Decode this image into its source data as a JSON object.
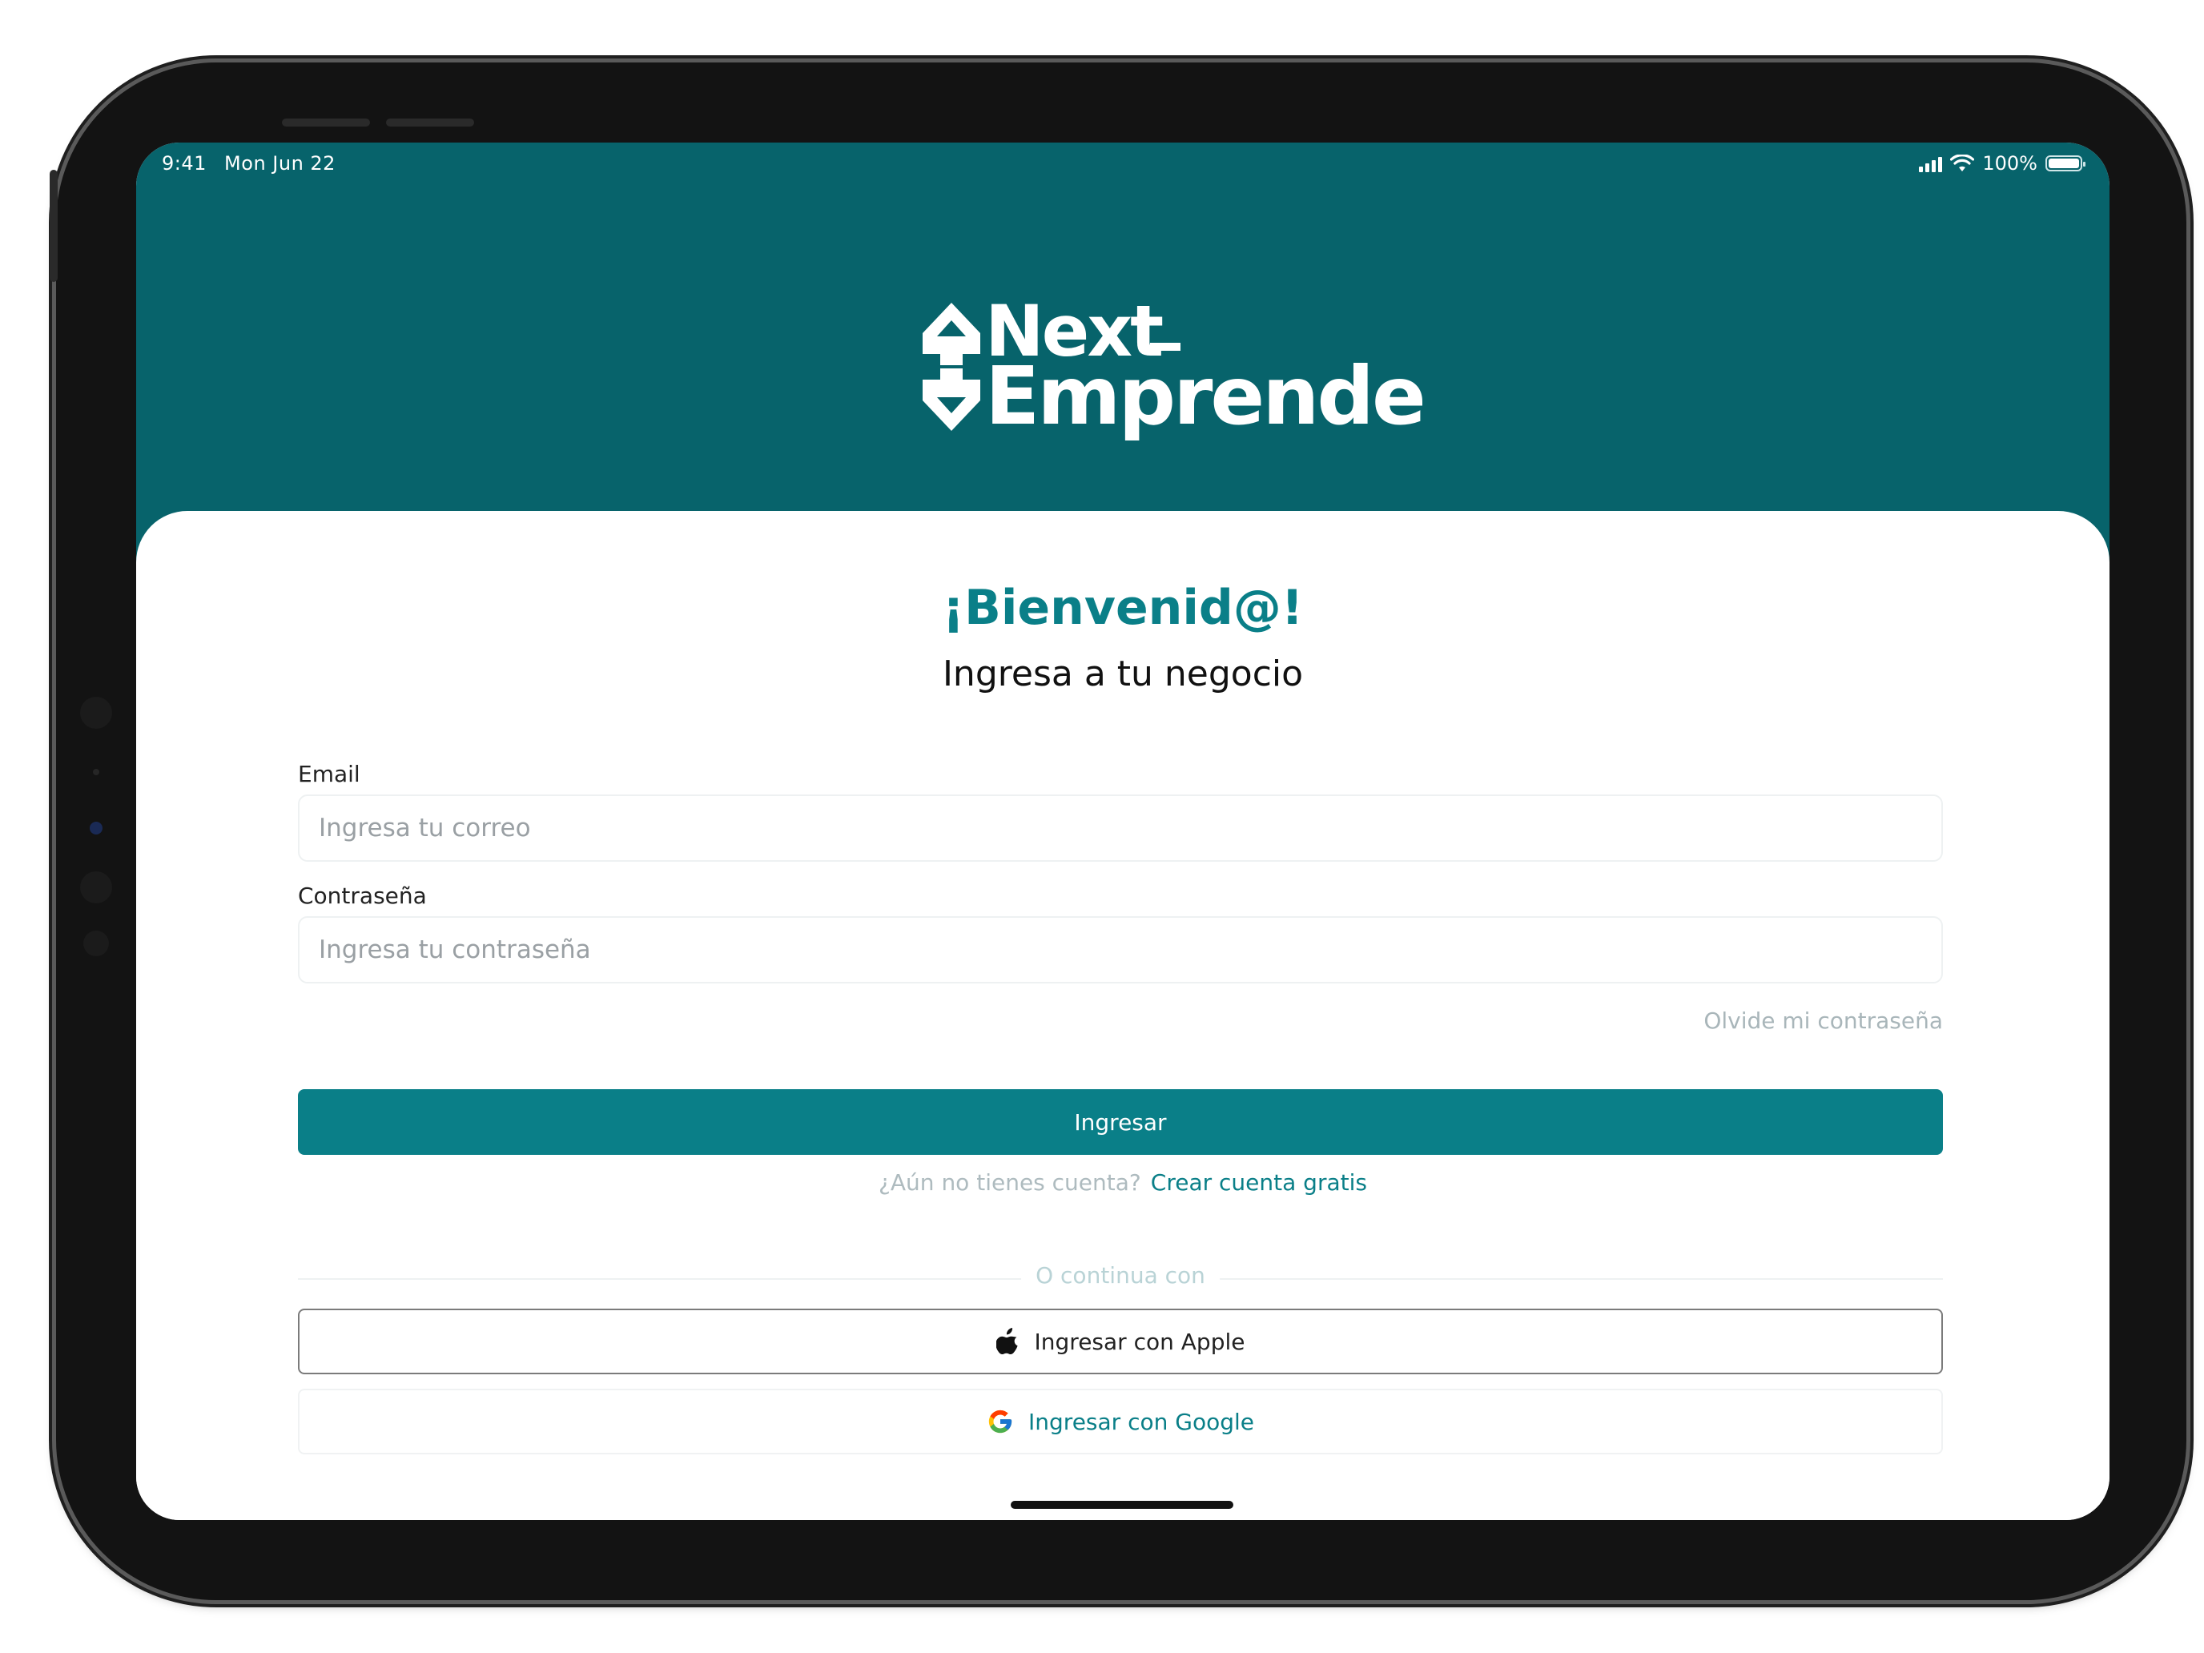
{
  "status_bar": {
    "time": "9:41",
    "date": "Mon Jun 22",
    "battery_text": "100%",
    "battery_level": 1.0
  },
  "brand": {
    "line1": "Next",
    "line2": "Emprende",
    "header_color": "#07636b",
    "accent_color": "#0a7f88"
  },
  "login": {
    "welcome": "¡Bienvenid@!",
    "subtitle": "Ingresa a tu negocio",
    "email_label": "Email",
    "email_placeholder": "Ingresa tu correo",
    "email_value": "",
    "password_label": "Contraseña",
    "password_placeholder": "Ingresa tu contraseña",
    "password_value": "",
    "forgot_link": "Olvide mi contraseña",
    "submit_label": "Ingresar",
    "no_account_text": "¿Aún no tienes cuenta?",
    "create_account_link": "Crear cuenta gratis",
    "divider_text": "O continua con",
    "apple_label": "Ingresar con Apple",
    "google_label": "Ingresar con Google"
  },
  "icons": {
    "logo": "up-down-arrows-logo",
    "apple": "apple-icon",
    "google": "google-icon",
    "signal": "cellular-signal-icon",
    "wifi": "wifi-icon",
    "battery": "battery-icon"
  }
}
